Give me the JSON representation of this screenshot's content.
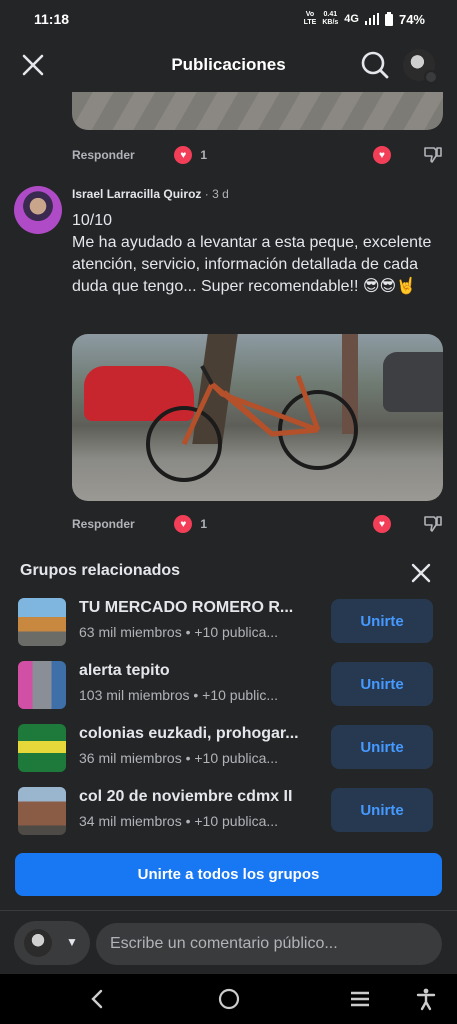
{
  "status": {
    "time": "11:18",
    "volte": "Vo\nLTE",
    "speed_value": "0.41",
    "speed_unit": "KB/s",
    "network": "4G",
    "battery": "74%"
  },
  "header": {
    "title": "Publicaciones"
  },
  "previous_comment": {
    "reply_label": "Responder",
    "reaction_count": "1"
  },
  "comment": {
    "author": "Israel Larracilla Quiroz",
    "time": "· 3 d",
    "line1": "10/10",
    "text": "Me ha ayudado a levantar a esta peque, excelente atención, servicio, información detallada de cada duda que tengo... Super recomendable!! 😎😎🤘",
    "reply_label": "Responder",
    "reaction_count": "1"
  },
  "groups": {
    "title": "Grupos relacionados",
    "join_all_label": "Unirte a todos los grupos",
    "items": [
      {
        "name": "TU MERCADO ROMERO R...",
        "meta": "63 mil miembros • +10 publica...",
        "join_label": "Unirte"
      },
      {
        "name": "alerta tepito",
        "meta": "103 mil miembros • +10 public...",
        "join_label": "Unirte"
      },
      {
        "name": "colonias euzkadi, prohogar...",
        "meta": "36 mil miembros • +10 publica...",
        "join_label": "Unirte"
      },
      {
        "name": "col 20 de noviembre cdmx II",
        "meta": "34 mil miembros • +10 publica...",
        "join_label": "Unirte"
      }
    ]
  },
  "composer": {
    "placeholder": "Escribe un comentario público..."
  },
  "colors": {
    "background": "#242526",
    "primary": "#1877f2",
    "join_bg": "#263951",
    "join_text": "#4599ff",
    "heart": "#f33e58"
  }
}
